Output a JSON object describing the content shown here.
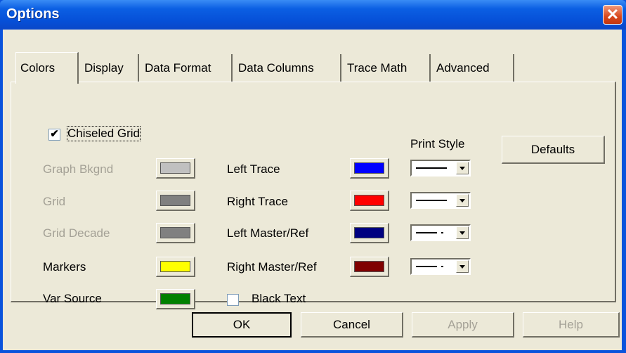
{
  "window": {
    "title": "Options",
    "close_glyph": "✕"
  },
  "tabs": [
    {
      "label": "Colors",
      "active": true
    },
    {
      "label": "Display"
    },
    {
      "label": "Data Format"
    },
    {
      "label": "Data Columns"
    },
    {
      "label": "Trace Math"
    },
    {
      "label": "Advanced"
    }
  ],
  "colors_panel": {
    "chiseled_grid": {
      "label": "Chiseled Grid",
      "checked": true,
      "check_glyph": "✔"
    },
    "left_column": [
      {
        "label": "Graph Bkgnd",
        "enabled": false,
        "color": "#c0c0c0"
      },
      {
        "label": "Grid",
        "enabled": false,
        "color": "#808080"
      },
      {
        "label": "Grid Decade",
        "enabled": false,
        "color": "#808080"
      },
      {
        "label": "Markers",
        "enabled": true,
        "color": "#ffff00"
      },
      {
        "label": "Var Source",
        "enabled": true,
        "color": "#008000"
      }
    ],
    "right_column": [
      {
        "label": "Left Trace",
        "color": "#0000ff",
        "print_style": "solid"
      },
      {
        "label": "Right Trace",
        "color": "#ff0000",
        "print_style": "solid"
      },
      {
        "label": "Left Master/Ref",
        "color": "#000080",
        "print_style": "dash-dot"
      },
      {
        "label": "Right Master/Ref",
        "color": "#800000",
        "print_style": "dash-dot"
      }
    ],
    "print_style_header": "Print Style",
    "black_text": {
      "label": "Black Text",
      "checked": false
    },
    "defaults_button": "Defaults"
  },
  "footer": {
    "ok": "OK",
    "cancel": "Cancel",
    "apply": "Apply",
    "help": "Help"
  }
}
